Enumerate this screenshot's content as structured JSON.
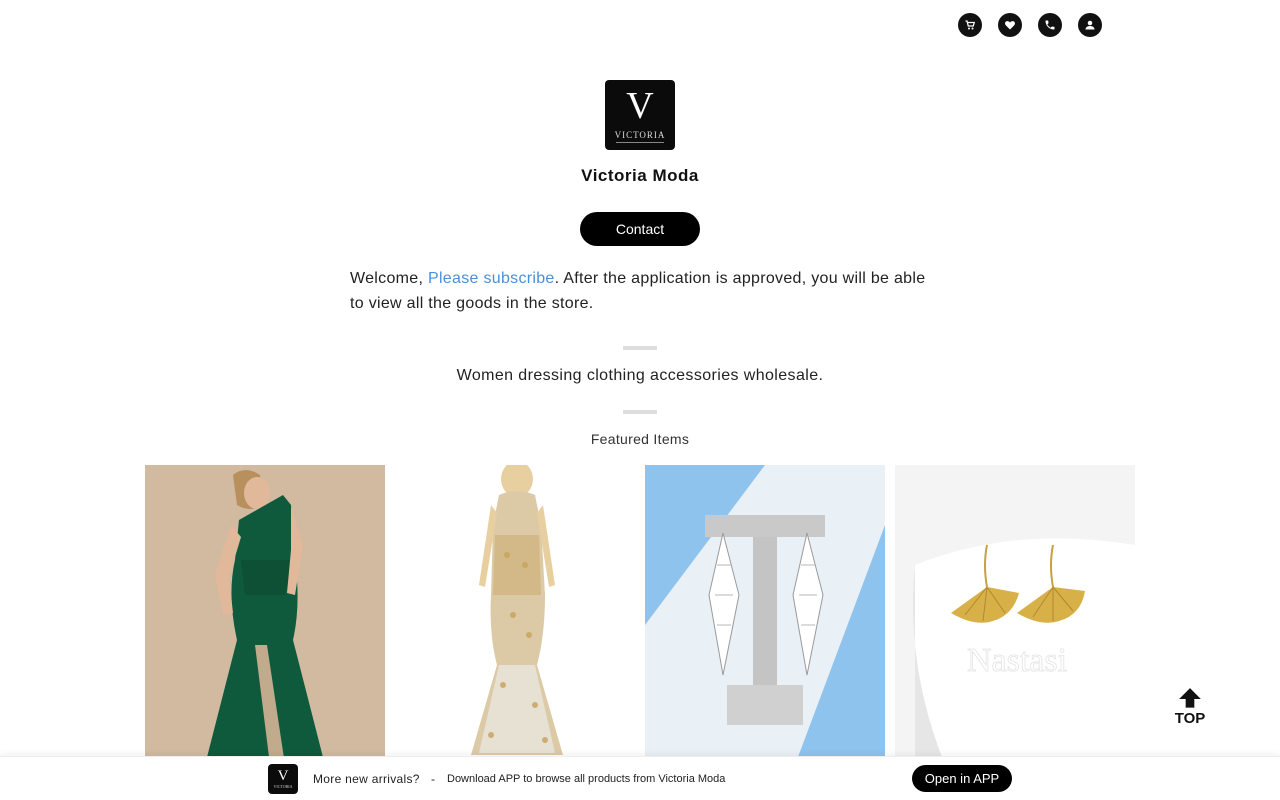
{
  "header": {
    "icons": [
      "cart-icon",
      "heart-icon",
      "phone-icon",
      "user-icon"
    ]
  },
  "store": {
    "logo_letter": "V",
    "logo_word": "VICTORIA",
    "name": "Victoria Moda",
    "contact_label": "Contact"
  },
  "welcome": {
    "prefix": "Welcome, ",
    "link": "Please subscribe",
    "suffix": ". After the application is approved, you will be able to view all the goods in the store."
  },
  "tagline": "Women dressing clothing accessories wholesale.",
  "featured": {
    "title": "Featured Items",
    "items": [
      {
        "label": "green one-shoulder satin gown"
      },
      {
        "label": "gold sequin mermaid gown"
      },
      {
        "label": "rhinestone tassel earrings"
      },
      {
        "label": "gold ginkgo leaf earrings",
        "watermark": "Nastasi"
      }
    ]
  },
  "top_button": {
    "label": "TOP"
  },
  "app_bar": {
    "title": "More new arrivals?",
    "separator": "-",
    "description": "Download APP to browse all products from Victoria Moda",
    "button": "Open in APP"
  },
  "colors": {
    "accent_link": "#4a90d9",
    "dark": "#000000"
  }
}
